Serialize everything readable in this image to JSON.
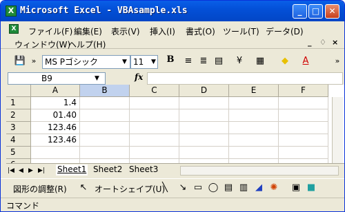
{
  "window": {
    "title": "Microsoft Excel - VBAsample.xls",
    "app_icon_glyph": "X",
    "buttons": {
      "minimize": "_",
      "maximize": "□",
      "close": "✕"
    }
  },
  "menubar": {
    "items": [
      "ファイル(F)",
      "編集(E)",
      "表示(V)",
      "挿入(I)",
      "書式(O)",
      "ツール(T)",
      "データ(D)",
      "ウィンドウ(W)",
      "ヘルプ(H)"
    ],
    "doc_controls": {
      "minimize": "_",
      "restore": "♢",
      "close": "×"
    }
  },
  "toolbar": {
    "font_name": "MS Pゴシック",
    "font_size": "11",
    "bold_label": "B",
    "more": "»"
  },
  "formula_bar": {
    "name_box": "B9",
    "fx_label": "fx",
    "value": ""
  },
  "sheet": {
    "columns": [
      "A",
      "B",
      "C",
      "D",
      "E",
      "F"
    ],
    "selected_column": "B",
    "rows": [
      {
        "num": "1",
        "a": "1.4"
      },
      {
        "num": "2",
        "a": "01.40"
      },
      {
        "num": "3",
        "a": "123.46"
      },
      {
        "num": "4",
        "a": "123.46"
      },
      {
        "num": "5",
        "a": ""
      },
      {
        "num": "6",
        "a": ""
      }
    ]
  },
  "tabs": [
    "Sheet1",
    "Sheet2",
    "Sheet3"
  ],
  "active_tab": "Sheet1",
  "drawing_toolbar": {
    "draw_label": "図形の調整(R)",
    "autoshape_label": "オートシェイプ(U)"
  },
  "status": "コマンド"
}
